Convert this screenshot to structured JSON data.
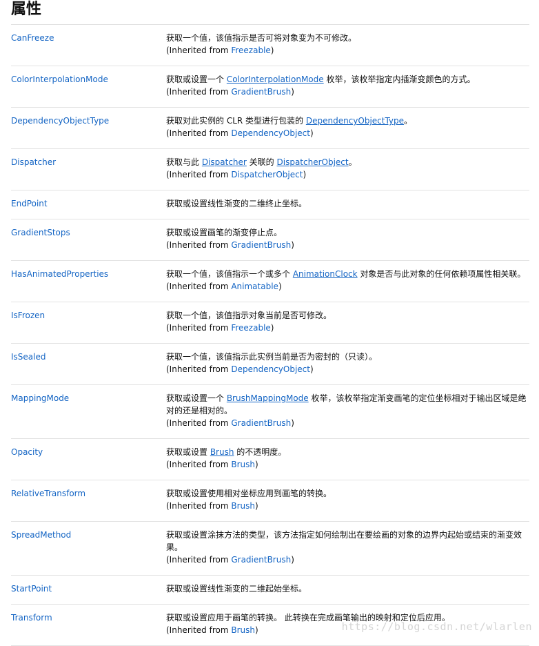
{
  "heading": "属性",
  "inherited_prefix": "(Inherited from ",
  "inherited_suffix": ")",
  "rows": [
    {
      "name": "CanFreeze",
      "desc": [
        {
          "t": "获取一个值，该值指示是否可将对象变为不可修改。"
        }
      ],
      "inherited": "Freezable"
    },
    {
      "name": "ColorInterpolationMode",
      "desc": [
        {
          "t": "获取或设置一个 "
        },
        {
          "t": "ColorInterpolationMode",
          "link": true
        },
        {
          "t": " 枚举，该枚举指定内插渐变颜色的方式。"
        }
      ],
      "inherited": "GradientBrush"
    },
    {
      "name": "DependencyObjectType",
      "desc": [
        {
          "t": "获取对此实例的 CLR 类型进行包装的 "
        },
        {
          "t": "DependencyObjectType",
          "link": true
        },
        {
          "t": "。"
        }
      ],
      "inherited": "DependencyObject"
    },
    {
      "name": "Dispatcher",
      "desc": [
        {
          "t": "获取与此 "
        },
        {
          "t": "Dispatcher",
          "link": true
        },
        {
          "t": " 关联的 "
        },
        {
          "t": "DispatcherObject",
          "link": true
        },
        {
          "t": "。"
        }
      ],
      "inherited": "DispatcherObject"
    },
    {
      "name": "EndPoint",
      "desc": [
        {
          "t": "获取或设置线性渐变的二维终止坐标。"
        }
      ],
      "inherited": null
    },
    {
      "name": "GradientStops",
      "desc": [
        {
          "t": "获取或设置画笔的渐变停止点。"
        }
      ],
      "inherited": "GradientBrush"
    },
    {
      "name": "HasAnimatedProperties",
      "desc": [
        {
          "t": "获取一个值，该值指示一个或多个 "
        },
        {
          "t": "AnimationClock",
          "link": true
        },
        {
          "t": " 对象是否与此对象的任何依赖项属性相关联。"
        }
      ],
      "inherited": "Animatable"
    },
    {
      "name": "IsFrozen",
      "desc": [
        {
          "t": "获取一个值，该值指示对象当前是否可修改。"
        }
      ],
      "inherited": "Freezable"
    },
    {
      "name": "IsSealed",
      "desc": [
        {
          "t": "获取一个值，该值指示此实例当前是否为密封的（只读）。"
        }
      ],
      "inherited": "DependencyObject"
    },
    {
      "name": "MappingMode",
      "desc": [
        {
          "t": "获取或设置一个 "
        },
        {
          "t": "BrushMappingMode",
          "link": true
        },
        {
          "t": " 枚举，该枚举指定渐变画笔的定位坐标相对于输出区域是绝对的还是相对的。"
        }
      ],
      "inherited": "GradientBrush"
    },
    {
      "name": "Opacity",
      "desc": [
        {
          "t": "获取或设置 "
        },
        {
          "t": "Brush",
          "link": true
        },
        {
          "t": " 的不透明度。"
        }
      ],
      "inherited": "Brush"
    },
    {
      "name": "RelativeTransform",
      "desc": [
        {
          "t": "获取或设置使用相对坐标应用到画笔的转换。"
        }
      ],
      "inherited": "Brush"
    },
    {
      "name": "SpreadMethod",
      "desc": [
        {
          "t": "获取或设置涂抹方法的类型，该方法指定如何绘制出在要绘画的对象的边界内起始或结束的渐变效果。"
        }
      ],
      "inherited": "GradientBrush"
    },
    {
      "name": "StartPoint",
      "desc": [
        {
          "t": "获取或设置线性渐变的二维起始坐标。"
        }
      ],
      "inherited": null
    },
    {
      "name": "Transform",
      "desc": [
        {
          "t": "获取或设置应用于画笔的转换。 此转换在完成画笔输出的映射和定位后应用。"
        }
      ],
      "inherited": "Brush"
    }
  ],
  "watermark": "https://blog.csdn.net/wlarlen"
}
